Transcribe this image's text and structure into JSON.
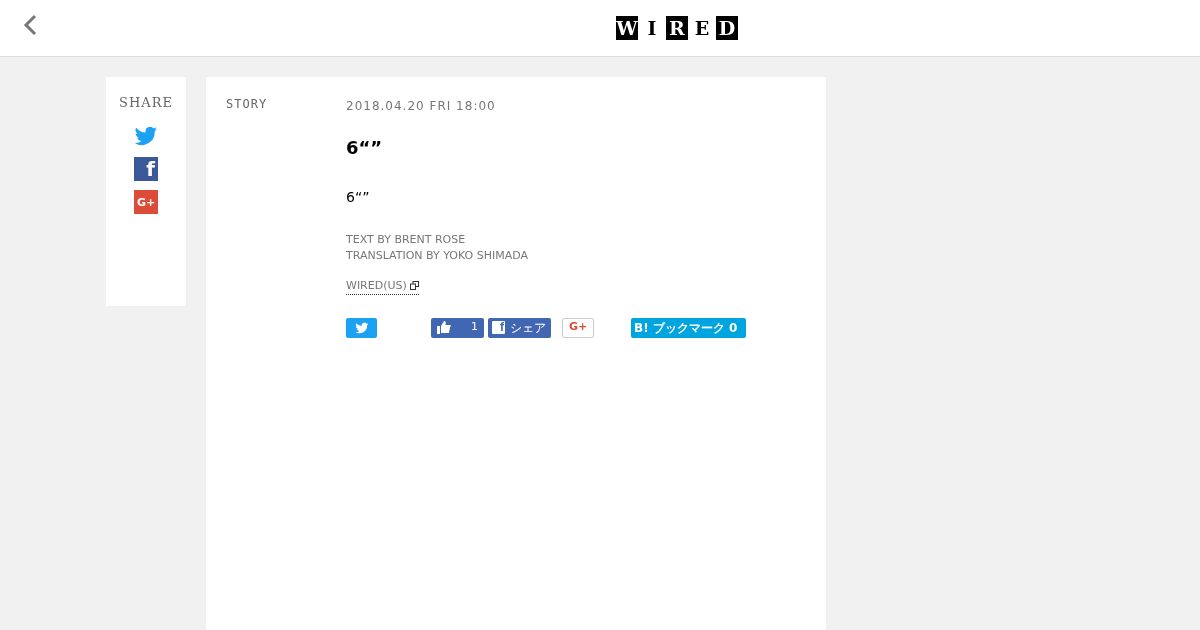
{
  "header": {
    "logo": [
      {
        "letter": "W",
        "filled": true
      },
      {
        "letter": "I",
        "filled": false
      },
      {
        "letter": "R",
        "filled": true
      },
      {
        "letter": "E",
        "filled": false
      },
      {
        "letter": "D",
        "filled": true
      }
    ]
  },
  "share": {
    "title": "SHARE",
    "items": [
      {
        "kind": "twitter"
      },
      {
        "kind": "facebook",
        "glyph": "f"
      },
      {
        "kind": "googleplus",
        "glyph": "G+"
      }
    ]
  },
  "article": {
    "category": "STORY",
    "date": "2018.04.20 FRI 18:00",
    "title": "6“”",
    "lead": "6“”",
    "credits": [
      "TEXT BY BRENT ROSE",
      "TRANSLATION BY YOKO SHIMADA"
    ],
    "source": "WIRED(US)",
    "social": [
      {
        "kind": "tweet"
      },
      {
        "kind": "like",
        "count": "1"
      },
      {
        "kind": "fbshare",
        "glyph": "f",
        "label": "シェア"
      },
      {
        "kind": "gplus",
        "glyph": "G+"
      },
      {
        "kind": "hatena",
        "glyph": "B!",
        "label": "ブックマーク",
        "count": "0"
      }
    ]
  }
}
